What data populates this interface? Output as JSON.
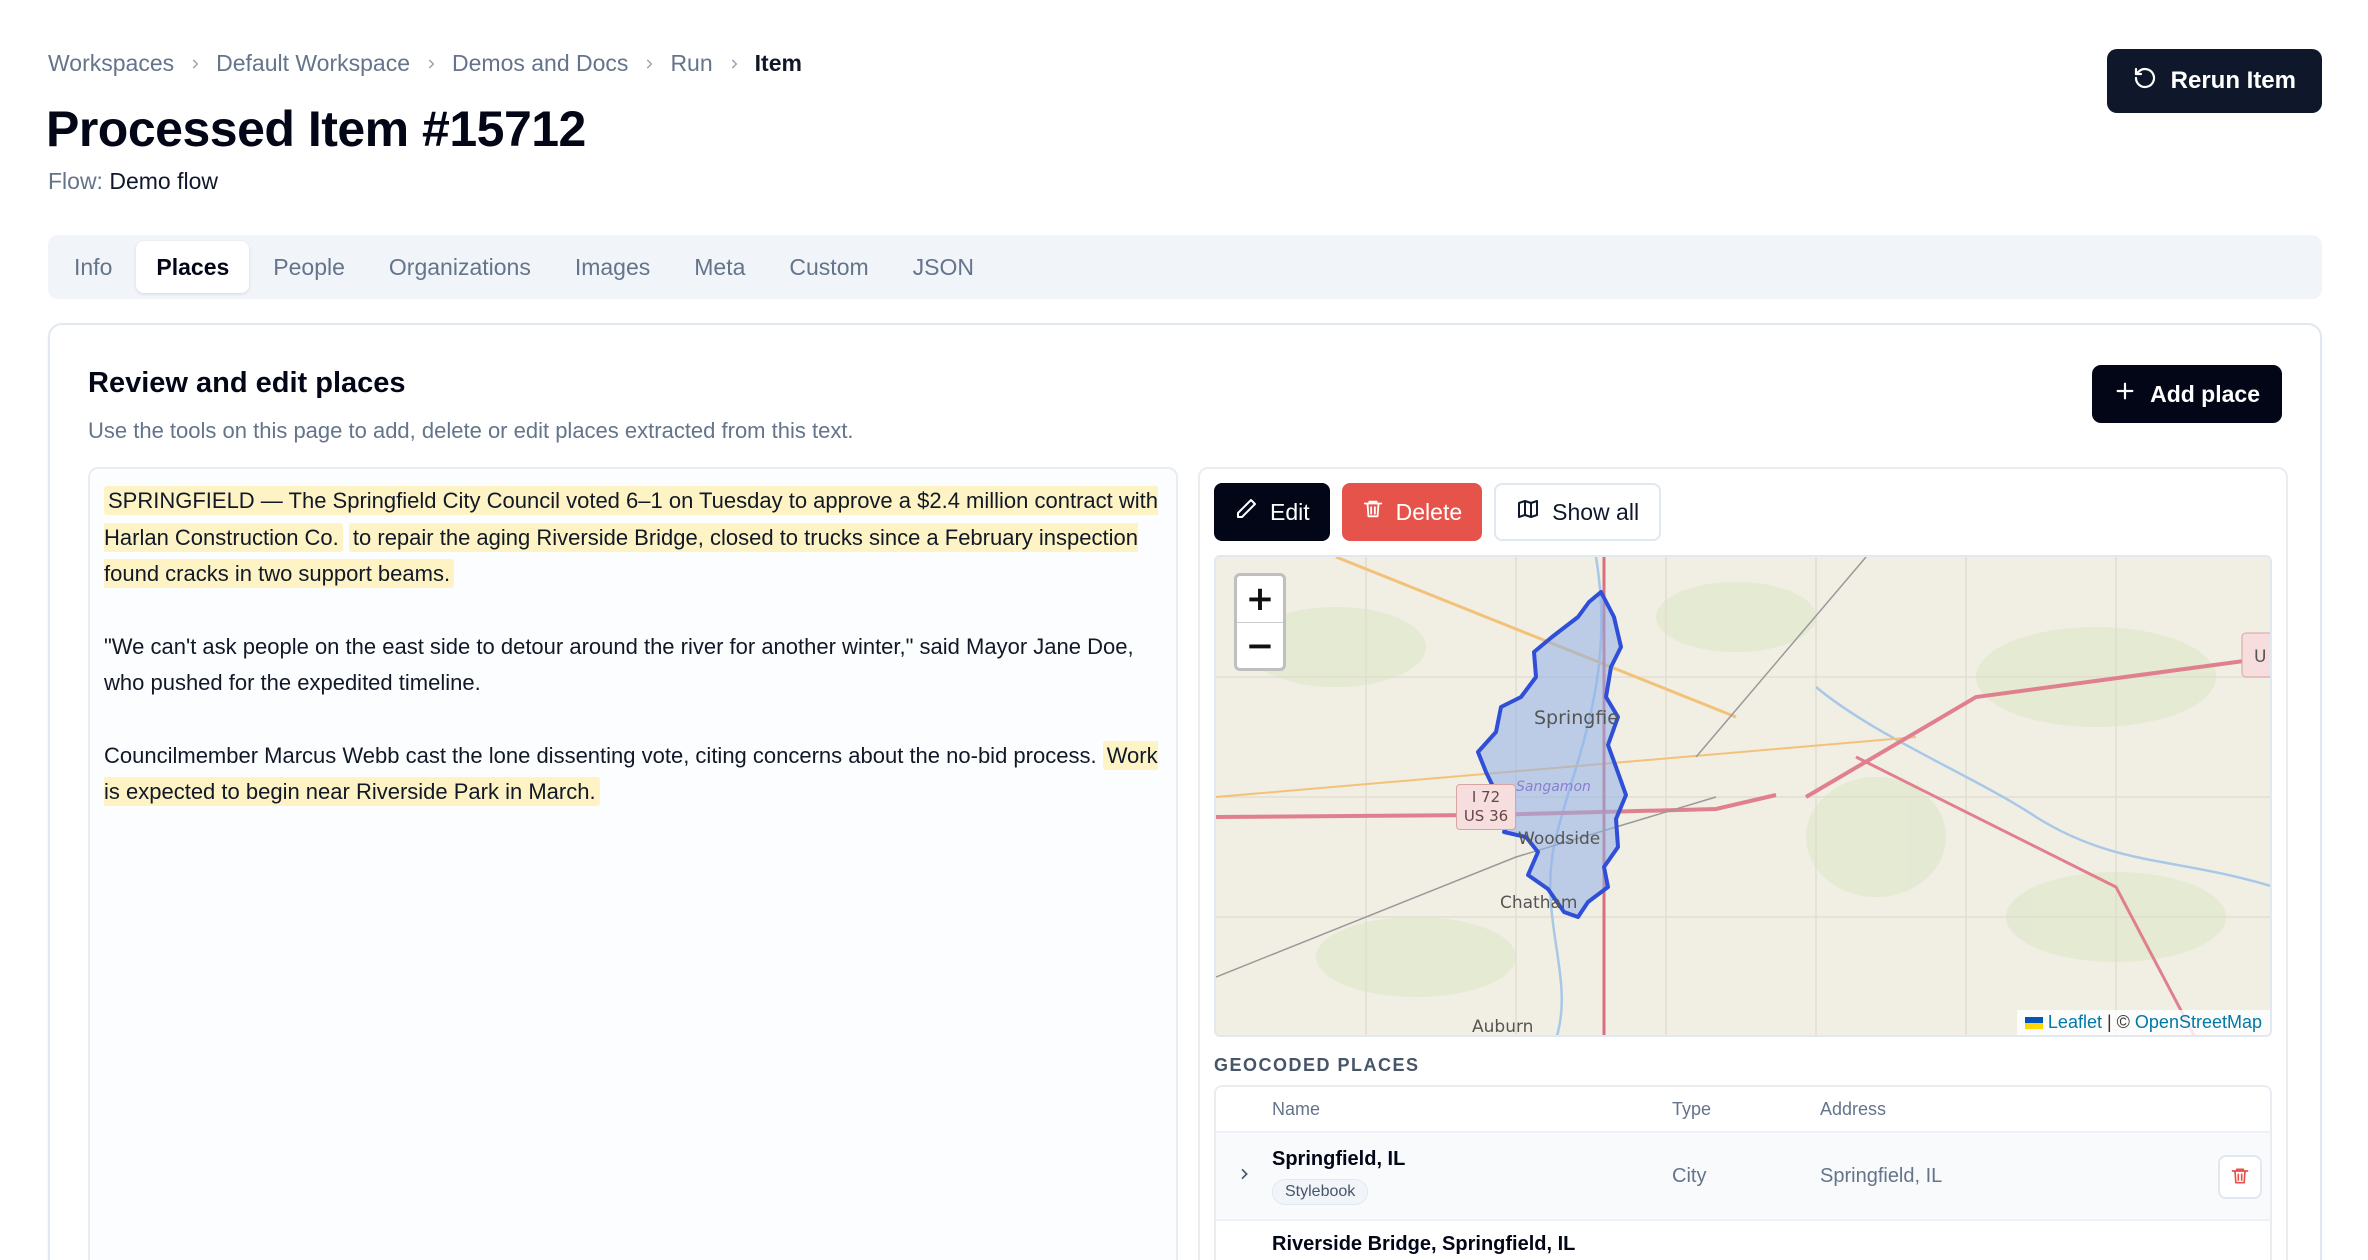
{
  "breadcrumb": {
    "items": [
      "Workspaces",
      "Default Workspace",
      "Demos and Docs",
      "Run",
      "Item"
    ]
  },
  "header": {
    "title": "Processed Item #15712",
    "flow_label": "Flow:",
    "flow_value": "Demo flow",
    "rerun_label": "Rerun Item"
  },
  "tabs": [
    {
      "label": "Info",
      "active": false
    },
    {
      "label": "Places",
      "active": true
    },
    {
      "label": "People",
      "active": false
    },
    {
      "label": "Organizations",
      "active": false
    },
    {
      "label": "Images",
      "active": false
    },
    {
      "label": "Meta",
      "active": false
    },
    {
      "label": "Custom",
      "active": false
    },
    {
      "label": "JSON",
      "active": false
    }
  ],
  "card": {
    "title": "Review and edit places",
    "description": "Use the tools on this page to add, delete or edit places extracted from this text.",
    "add_label": "Add place"
  },
  "text": {
    "p1_hl1": "SPRINGFIELD — The Springfield City Council voted 6–1 on Tuesday to approve a $2.4 million contract with Harlan Construction Co.",
    "p1_hl2": "to repair the aging Riverside Bridge, closed to trucks since a February inspection found cracks in two support beams.",
    "p2": "\"We can't ask people on the east side to detour around the river for another winter,\" said Mayor Jane Doe, who pushed for the expedited timeline.",
    "p3_plain": "Councilmember Marcus Webb cast the lone dissenting vote, citing concerns about the no-bid process.",
    "p3_hl": "Work is expected to begin near Riverside Park in March."
  },
  "toolbar": {
    "edit_label": "Edit",
    "delete_label": "Delete",
    "showall_label": "Show all"
  },
  "map": {
    "labels": {
      "city": "Springfie",
      "sangamon": "Sangamon",
      "woodside": "Woodside",
      "chatham": "Chatham",
      "auburn": "Auburn",
      "edge": "U"
    },
    "shield_line1": "I 72",
    "shield_line2": "US 36",
    "attribution_leaflet": "Leaflet",
    "attribution_sep": "| ©",
    "attribution_osm": "OpenStreetMap",
    "zoom_in": "+",
    "zoom_out": "−",
    "boundary_color": "#2f4fd8",
    "fill_color": "#8fb0e8"
  },
  "places": {
    "section_label": "GEOCODED PLACES",
    "columns": {
      "name": "Name",
      "type": "Type",
      "address": "Address"
    },
    "rows": [
      {
        "name": "Springfield, IL",
        "badge": "Stylebook",
        "type": "City",
        "address": "Springfield, IL"
      },
      {
        "name": "Riverside Bridge, Springfield, IL",
        "badge": "",
        "type": "",
        "address": ""
      }
    ]
  }
}
